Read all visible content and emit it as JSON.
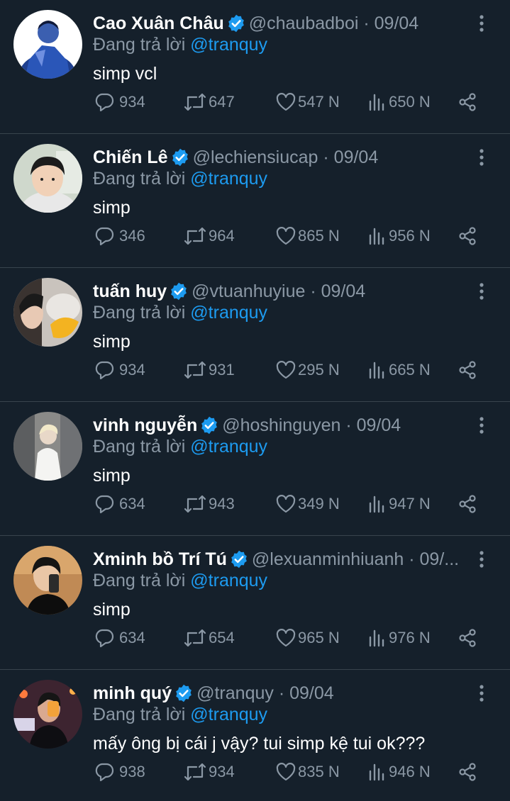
{
  "colors": {
    "background": "#15202b",
    "divider": "#38444d",
    "muted": "#8b98a5",
    "accent": "#1d9bf0",
    "text": "#ffffff"
  },
  "reply_prefix": "Đang trả lời",
  "icons": {
    "verified": "verified-badge-icon",
    "more": "more-vertical-icon",
    "reply": "reply-bubble-icon",
    "retweet": "retweet-icon",
    "like": "heart-icon",
    "views": "views-chart-icon",
    "share": "share-icon"
  },
  "tweets": [
    {
      "name": "Cao Xuân Châu",
      "handle_date": "@chaubadboi · 09/04",
      "reply_to": "@tranquy",
      "text": "simp vcl",
      "replies": "934",
      "retweets": "647",
      "likes": "547 N",
      "views": "650 N"
    },
    {
      "name": "Chiến Lê",
      "handle_date": "@lechiensiucap · 09/04",
      "reply_to": "@tranquy",
      "text": "simp",
      "replies": "346",
      "retweets": "964",
      "likes": "865 N",
      "views": "956 N"
    },
    {
      "name": "tuấn huy",
      "handle_date": "@vtuanhuyiue · 09/04",
      "reply_to": "@tranquy",
      "text": "simp",
      "replies": "934",
      "retweets": "931",
      "likes": "295 N",
      "views": "665 N"
    },
    {
      "name": "vinh nguyễn",
      "handle_date": "@hoshinguyen · 09/04",
      "reply_to": "@tranquy",
      "text": "simp",
      "replies": "634",
      "retweets": "943",
      "likes": "349 N",
      "views": "947 N"
    },
    {
      "name": "Xminh bồ Trí Tú",
      "handle_date": "@lexuanminhiuanh · 09/...",
      "reply_to": "@tranquy",
      "text": "simp",
      "replies": "634",
      "retweets": "654",
      "likes": "965 N",
      "views": "976 N"
    },
    {
      "name": "minh quý",
      "handle_date": "@tranquy · 09/04",
      "reply_to": "@tranquy",
      "text": "mấy ông bị cái j vậy? tui simp kệ tui ok???",
      "replies": "938",
      "retweets": "934",
      "likes": "835 N",
      "views": "946 N"
    }
  ]
}
